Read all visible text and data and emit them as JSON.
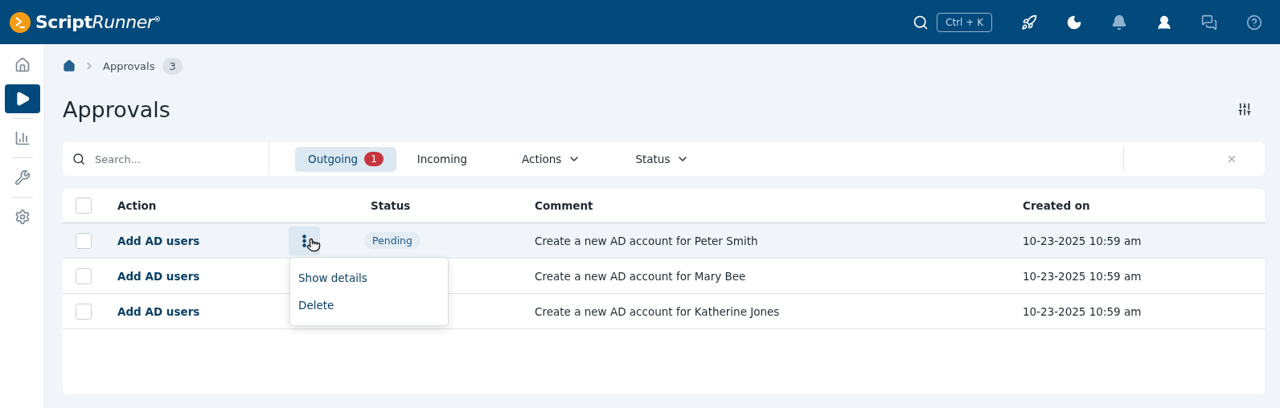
{
  "app": {
    "logo_name": "Script",
    "logo_accent": "Runner",
    "logo_mark": "®",
    "shortcut": "Ctrl + K"
  },
  "sidebar": {
    "items": [
      {
        "selected": false
      },
      {
        "selected": true
      },
      {
        "selected": false
      },
      {
        "selected": false
      },
      {
        "selected": false
      }
    ]
  },
  "breadcrumb": {
    "label": "Approvals",
    "count": "3"
  },
  "page_title": "Approvals",
  "filter_bar": {
    "search": {
      "placeholder": "Search..."
    },
    "tabs": [
      {
        "label": "Outgoing",
        "badge": "1",
        "selected": true,
        "kind": "tab"
      },
      {
        "label": "Incoming",
        "selected": false,
        "kind": "tab"
      },
      {
        "label": "Actions",
        "selected": false,
        "kind": "dropdown"
      },
      {
        "label": "Status",
        "selected": false,
        "kind": "dropdown"
      }
    ]
  },
  "table": {
    "all_checked": false,
    "columns": [
      "Action",
      "Status",
      "Comment",
      "Created on"
    ],
    "rows": [
      {
        "checked": false,
        "action": "Add AD users",
        "status": "Pending",
        "comment": "Create a new AD account for Peter Smith",
        "created_on": "10-23-2025 10:59 am",
        "hovered": true
      },
      {
        "checked": false,
        "action": "Add AD users",
        "comment": "Create a new AD account for Mary Bee",
        "created_on": "10-23-2025 10:59 am",
        "hovered": false
      },
      {
        "checked": false,
        "action": "Add AD users",
        "comment": "Create a new AD account for Katherine Jones",
        "created_on": "10-23-2025 10:59 am",
        "hovered": false
      }
    ]
  },
  "row_menu": {
    "items": [
      "Show details",
      "Delete"
    ]
  }
}
